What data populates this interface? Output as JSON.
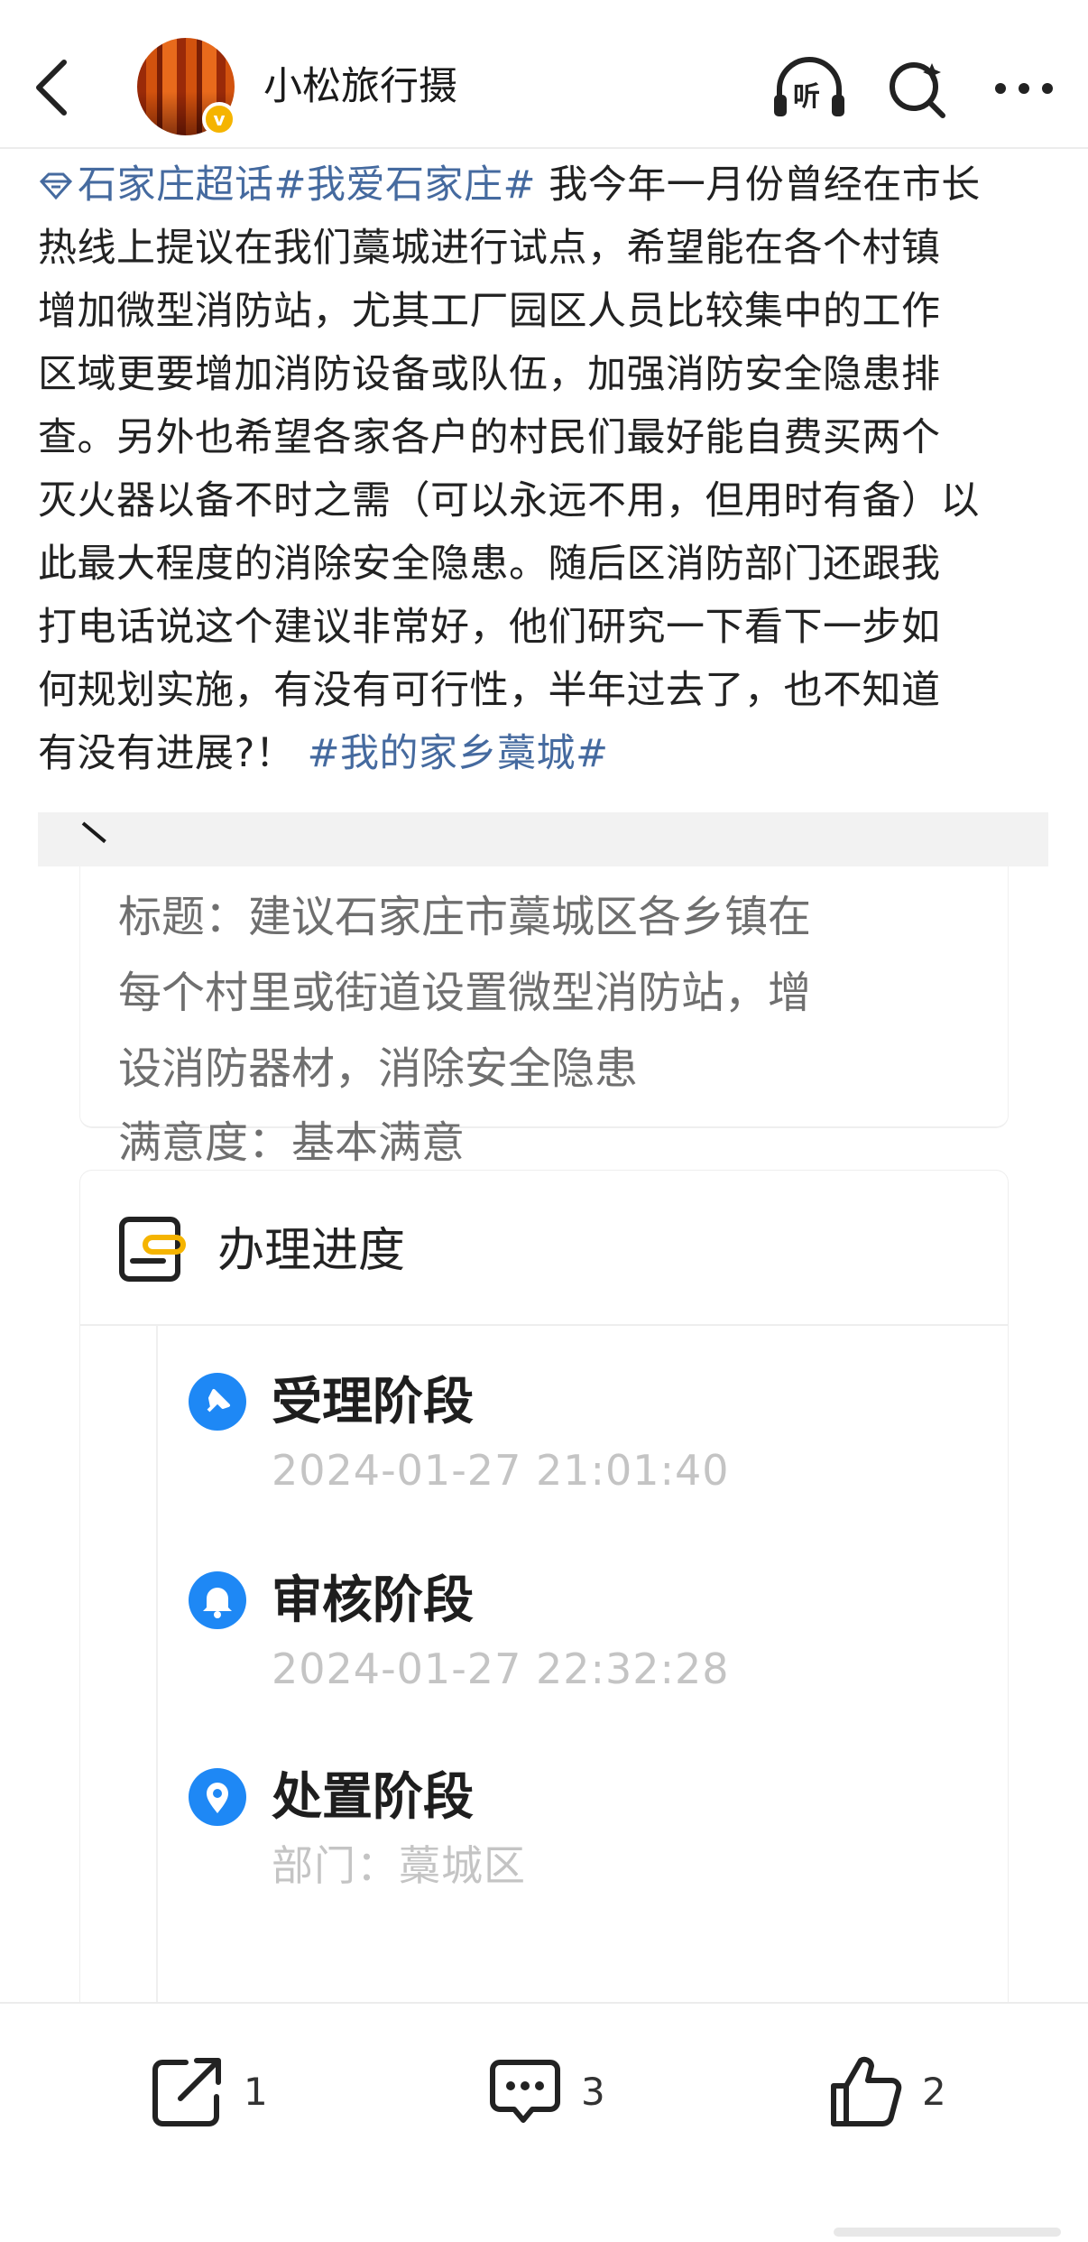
{
  "header": {
    "username": "小松旅行摄",
    "verified_mark": "v",
    "icons": [
      "back-arrow-icon",
      "listen-headphones-icon",
      "search-icon",
      "more-icon"
    ],
    "listen_label": "听"
  },
  "post": {
    "topic_1": "石家庄超话",
    "topic_2": "#我爱石家庄#",
    "body_lines": [
      " 我今年一月份曾经在市长",
      "热线上提议在我们藁城进行试点，希望能在各个村镇",
      "增加微型消防站，尤其工厂园区人员比较集中的工作",
      "区域更要增加消防设备或队伍，加强消防安全隐患排",
      "查。另外也希望各家各户的村民们最好能自费买两个",
      "灭火器以备不时之需（可以永远不用，但用时有备）以",
      "此最大程度的消除安全隐患。随后区消防部门还跟我",
      "打电话说这个建议非常好，他们研究一下看下一步如",
      "何规划实施，有没有可行性，半年过去了，也不知道"
    ],
    "last_line": "有没有进展?！ ",
    "topic_3": "#我的家乡藁城#"
  },
  "embed": {
    "title_lines": [
      "标题：建议石家庄市藁城区各乡镇在",
      "每个村里或街道设置微型消防站，增",
      "设消防器材，消除安全隐患"
    ],
    "satisfaction": "满意度：基本满意",
    "progress_title": "办理进度",
    "stages": [
      {
        "name": "受理阶段",
        "detail": "2024-01-27 21:01:40",
        "icon": "pin-icon"
      },
      {
        "name": "审核阶段",
        "detail": "2024-01-27 22:32:28",
        "icon": "bell-icon"
      },
      {
        "name": "处置阶段",
        "detail": "部门：藁城区",
        "icon": "location-icon"
      }
    ],
    "accent_color": "#1e88f5"
  },
  "actions": {
    "share_count": "1",
    "comment_count": "3",
    "like_count": "2"
  }
}
